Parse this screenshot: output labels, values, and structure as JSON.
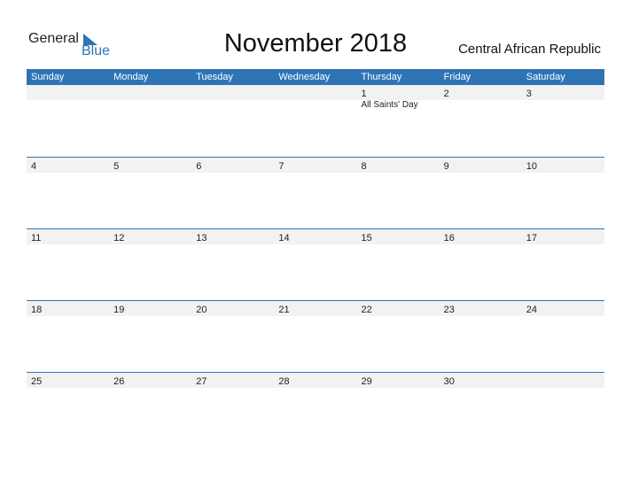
{
  "logo": {
    "general": "General",
    "blue": "Blue"
  },
  "title": "November 2018",
  "country": "Central African Republic",
  "colors": {
    "accent": "#2e74b5",
    "strip": "#f2f2f2"
  },
  "weekdays": [
    "Sunday",
    "Monday",
    "Tuesday",
    "Wednesday",
    "Thursday",
    "Friday",
    "Saturday"
  ],
  "weeks": [
    [
      {
        "day": ""
      },
      {
        "day": ""
      },
      {
        "day": ""
      },
      {
        "day": ""
      },
      {
        "day": "1",
        "holiday": "All Saints' Day"
      },
      {
        "day": "2"
      },
      {
        "day": "3"
      }
    ],
    [
      {
        "day": "4"
      },
      {
        "day": "5"
      },
      {
        "day": "6"
      },
      {
        "day": "7"
      },
      {
        "day": "8"
      },
      {
        "day": "9"
      },
      {
        "day": "10"
      }
    ],
    [
      {
        "day": "11"
      },
      {
        "day": "12"
      },
      {
        "day": "13"
      },
      {
        "day": "14"
      },
      {
        "day": "15"
      },
      {
        "day": "16"
      },
      {
        "day": "17"
      }
    ],
    [
      {
        "day": "18"
      },
      {
        "day": "19"
      },
      {
        "day": "20"
      },
      {
        "day": "21"
      },
      {
        "day": "22"
      },
      {
        "day": "23"
      },
      {
        "day": "24"
      }
    ],
    [
      {
        "day": "25"
      },
      {
        "day": "26"
      },
      {
        "day": "27"
      },
      {
        "day": "28"
      },
      {
        "day": "29"
      },
      {
        "day": "30"
      },
      {
        "day": ""
      }
    ]
  ]
}
